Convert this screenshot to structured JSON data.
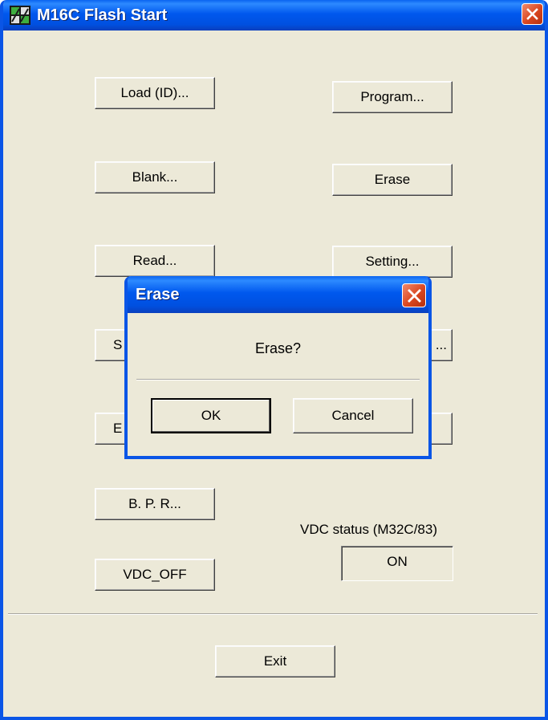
{
  "window": {
    "title": "M16C Flash Start",
    "buttons": {
      "load_id": "Load (ID)...",
      "program": "Program...",
      "blank": "Blank...",
      "erase": "Erase",
      "read": "Read...",
      "setting": "Setting...",
      "row4_left": "S",
      "row4_right": "...",
      "row5_left": "E",
      "row5_right": "",
      "bpr": "B. P. R...",
      "vdc_off": "VDC_OFF",
      "exit": "Exit"
    },
    "vdc": {
      "label": "VDC status (M32C/83)",
      "value": "ON"
    }
  },
  "dialog": {
    "title": "Erase",
    "message": "Erase?",
    "ok_label": "OK",
    "cancel_label": "Cancel"
  },
  "colors": {
    "titlebar_blue": "#0058ee",
    "face": "#ece9d8",
    "close_red": "#d9461f"
  }
}
